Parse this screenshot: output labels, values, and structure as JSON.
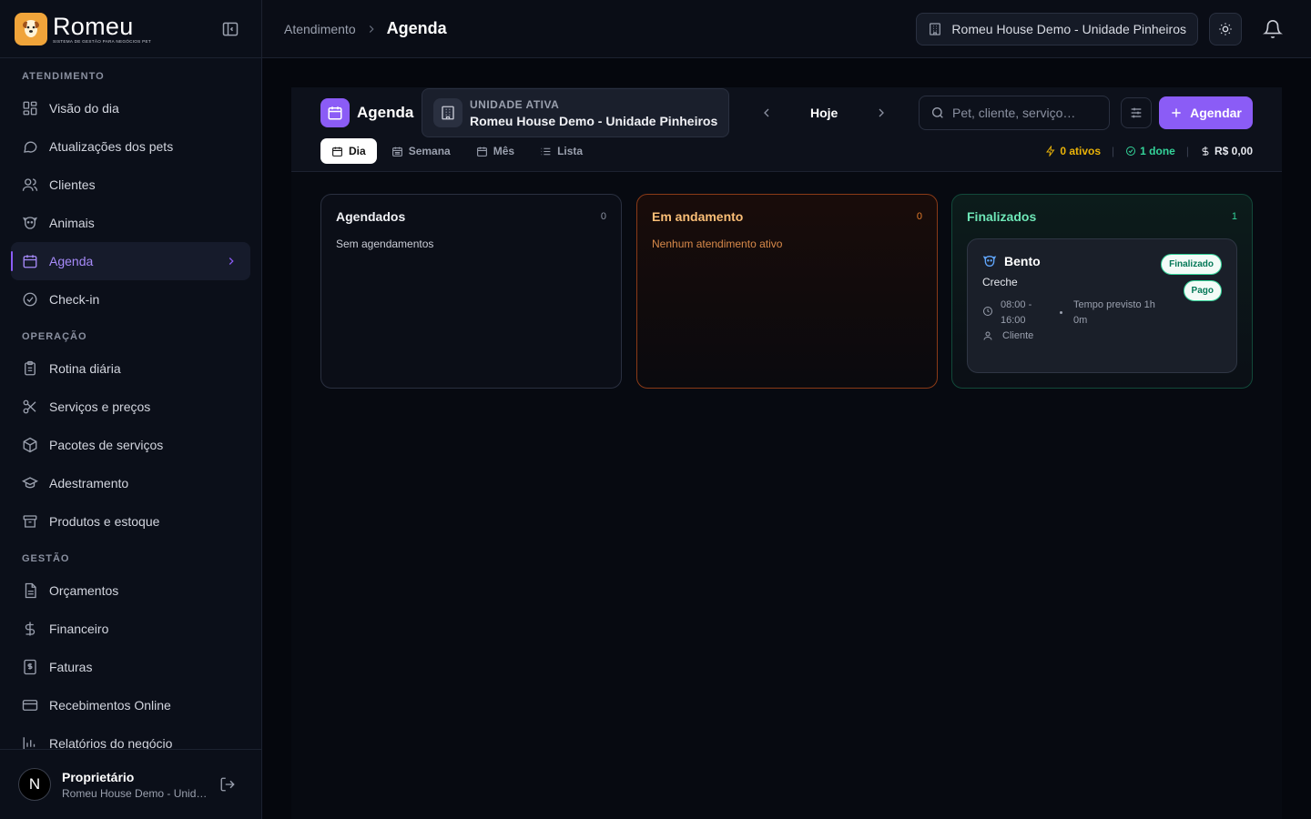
{
  "brand": {
    "name": "Romeu",
    "tagline": "SISTEMA DE GESTÃO PARA NEGÓCIOS PET"
  },
  "sidebar": {
    "sections": [
      {
        "title": "ATENDIMENTO",
        "items": [
          {
            "label": "Visão do dia",
            "icon": "grid-icon"
          },
          {
            "label": "Atualizações dos pets",
            "icon": "chat-icon"
          },
          {
            "label": "Clientes",
            "icon": "users-icon"
          },
          {
            "label": "Animais",
            "icon": "paw-icon"
          },
          {
            "label": "Agenda",
            "icon": "calendar-icon",
            "active": true
          },
          {
            "label": "Check-in",
            "icon": "check-circle-icon"
          }
        ]
      },
      {
        "title": "OPERAÇÃO",
        "items": [
          {
            "label": "Rotina diária",
            "icon": "clipboard-icon"
          },
          {
            "label": "Serviços e preços",
            "icon": "scissors-icon"
          },
          {
            "label": "Pacotes de serviços",
            "icon": "package-icon"
          },
          {
            "label": "Adestramento",
            "icon": "graduation-icon"
          },
          {
            "label": "Produtos e estoque",
            "icon": "archive-icon"
          }
        ]
      },
      {
        "title": "GESTÃO",
        "items": [
          {
            "label": "Orçamentos",
            "icon": "document-icon"
          },
          {
            "label": "Financeiro",
            "icon": "dollar-icon"
          },
          {
            "label": "Faturas",
            "icon": "invoice-icon"
          },
          {
            "label": "Recebimentos Online",
            "icon": "credit-card-icon"
          },
          {
            "label": "Relatórios do negócio",
            "icon": "bar-chart-icon"
          }
        ]
      }
    ]
  },
  "user": {
    "initial": "N",
    "name": "Proprietário",
    "unit": "Romeu House Demo - Unidade Pinheiros"
  },
  "header": {
    "breadcrumb_parent": "Atendimento",
    "breadcrumb_current": "Agenda",
    "unit_selector": "Romeu House Demo - Unidade Pinheiros"
  },
  "toolbar": {
    "title": "Agenda",
    "active_unit_label": "UNIDADE ATIVA",
    "active_unit_name": "Romeu House Demo - Unidade Pinheiros",
    "today_label": "Hoje",
    "search_placeholder": "Pet, cliente, serviço…",
    "book_label": "Agendar",
    "tabs": [
      {
        "label": "Dia",
        "icon": "calendar-day-icon",
        "active": true
      },
      {
        "label": "Semana",
        "icon": "calendar-week-icon"
      },
      {
        "label": "Mês",
        "icon": "calendar-month-icon"
      },
      {
        "label": "Lista",
        "icon": "list-icon"
      }
    ],
    "stats": {
      "active": "0 ativos",
      "done": "1 done",
      "revenue": "R$ 0,00"
    }
  },
  "columns": {
    "scheduled": {
      "title": "Agendados",
      "count": "0",
      "empty": "Sem agendamentos"
    },
    "in_progress": {
      "title": "Em andamento",
      "count": "0",
      "empty": "Nenhum atendimento ativo"
    },
    "finished": {
      "title": "Finalizados",
      "count": "1"
    }
  },
  "card": {
    "pet": "Bento",
    "service": "Creche",
    "status_badge": "Finalizado",
    "payment_badge": "Pago",
    "time": "08:00 - 16:00",
    "predicted": "Tempo previsto 1h 0m",
    "client": "Cliente"
  },
  "colors": {
    "accent": "#8b5cf6",
    "progress": "#e07a2a",
    "finished": "#34d399",
    "warning": "#eab308"
  }
}
